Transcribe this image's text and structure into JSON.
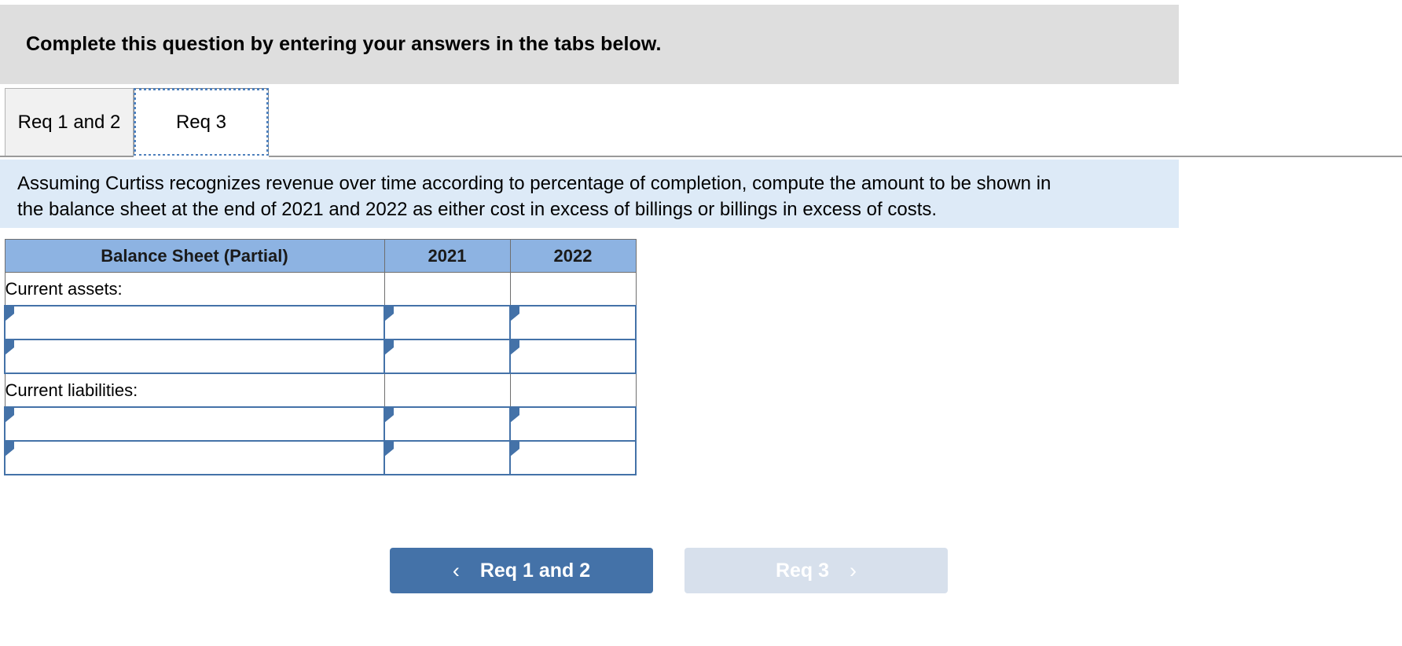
{
  "banner": {
    "heading": "Complete this question by entering your answers in the tabs below."
  },
  "tabs": [
    {
      "label": "Req 1 and 2",
      "active": false
    },
    {
      "label": "Req 3",
      "active": true
    }
  ],
  "instruction": {
    "line1": "Assuming Curtiss recognizes revenue over time according to percentage of completion, compute the amount to be shown in",
    "line2": "the balance sheet at the end of 2021 and 2022 as either cost in excess of billings or billings in excess of costs."
  },
  "table": {
    "headers": [
      "Balance Sheet (Partial)",
      "2021",
      "2022"
    ],
    "rows": [
      {
        "type": "static",
        "label": "Current assets:",
        "y2021": "",
        "y2022": ""
      },
      {
        "type": "input",
        "label": "",
        "y2021": "",
        "y2022": ""
      },
      {
        "type": "input",
        "label": "",
        "y2021": "",
        "y2022": ""
      },
      {
        "type": "static",
        "label": "Current liabilities:",
        "y2021": "",
        "y2022": ""
      },
      {
        "type": "input",
        "label": "",
        "y2021": "",
        "y2022": ""
      },
      {
        "type": "input",
        "label": "",
        "y2021": "",
        "y2022": ""
      }
    ]
  },
  "nav": {
    "prev_label": "Req 1 and 2",
    "prev_icon": "chevron-left-icon",
    "prev_glyph": "‹",
    "next_label": "Req 3",
    "next_icon": "chevron-right-icon",
    "next_glyph": "›"
  },
  "colors": {
    "banner_bg": "#dedede",
    "instruction_bg": "#ddeaf7",
    "table_header_bg": "#8db3e2",
    "input_border": "#4472a8",
    "button_active_bg": "#4472a8",
    "button_disabled_bg": "#d7e0ec",
    "tab_focus_outline": "#4f81bd"
  }
}
